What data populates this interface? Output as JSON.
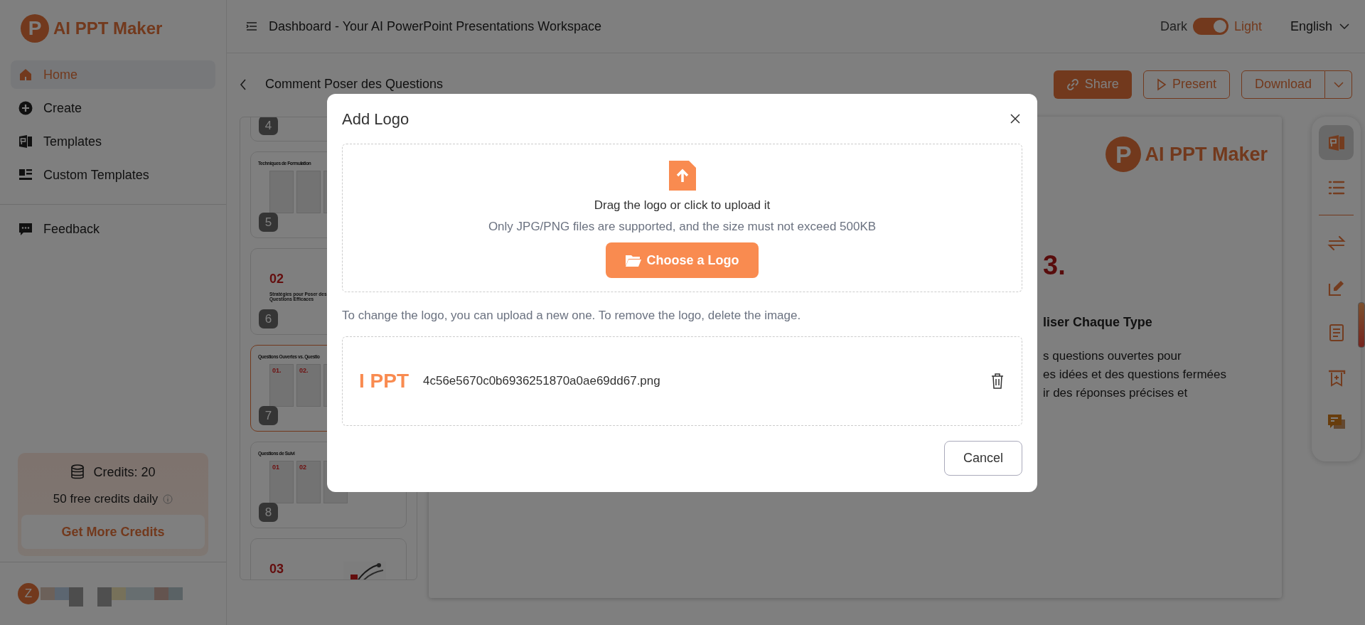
{
  "sidebar": {
    "logo": {
      "mark": "P",
      "name": "AI PPT Maker"
    },
    "nav": [
      {
        "label": "Home",
        "kind": "home",
        "selected": true
      },
      {
        "label": "Create",
        "kind": "create",
        "selected": false
      },
      {
        "label": "Templates",
        "kind": "templates",
        "selected": false
      },
      {
        "label": "Custom Templates",
        "kind": "custom",
        "selected": false
      }
    ],
    "secondary_nav": [
      {
        "label": "Feedback",
        "kind": "feedback",
        "selected": false
      }
    ],
    "credits": {
      "balance": "Credits: 20",
      "note": "50 free credits daily",
      "button": "Get More Credits"
    },
    "user": {
      "avatar": "Z"
    }
  },
  "topbar": {
    "title": "Dashboard - Your AI PowerPoint Presentations Workspace",
    "theme": [
      {
        "label": "Dark",
        "selected": false
      },
      {
        "label": "Light",
        "selected": true
      }
    ],
    "language": "English"
  },
  "presentation": {
    "title": "Comment Poser des Questions",
    "actions": [
      {
        "label": "Share",
        "kind": "primary"
      },
      {
        "label": "Present",
        "kind": "outline"
      },
      {
        "label": "Download",
        "kind": "split"
      }
    ]
  },
  "thumbnails": [
    {
      "number": "4",
      "kind": "blank",
      "selected": false
    },
    {
      "number": "5",
      "kind": "columns",
      "title": "Techniques de Formulation",
      "selected": false
    },
    {
      "number": "6",
      "kind": "section",
      "heading_number": "02",
      "title": "Stratégies pour Poser des Questions Efficaces",
      "selected": false
    },
    {
      "number": "7",
      "kind": "columns",
      "title": "Questions Ouvertes vs. Questio",
      "labels": [
        "01.",
        "02."
      ],
      "selected": true
    },
    {
      "number": "8",
      "kind": "columns",
      "title": "Questions de Suivi",
      "labels": [
        "01",
        "02"
      ],
      "selected": false
    },
    {
      "kind": "section_picture",
      "heading_number": "03",
      "selected": false
    }
  ],
  "slide": {
    "logo": {
      "mark": "P",
      "name": "AI PPT Maker"
    },
    "number": "3.",
    "heading": "liser Chaque Type",
    "body": [
      "s questions ouvertes pour",
      "es idées et des questions fermées",
      "ir des réponses précises et"
    ]
  },
  "tools": [
    {
      "kind": "slides",
      "selected": true
    },
    {
      "kind": "outline",
      "selected": false
    },
    {
      "kind": "switch",
      "selected": false
    },
    {
      "kind": "edit",
      "selected": false
    },
    {
      "kind": "notes",
      "selected": false
    },
    {
      "kind": "bookmark",
      "selected": false
    },
    {
      "kind": "comment",
      "selected": false
    }
  ],
  "modal": {
    "title": "Add Logo",
    "upload": {
      "prompt": "Drag the logo or click to upload it",
      "hint": "Only JPG/PNG files are supported, and the size must not exceed 500KB",
      "button": "Choose a Logo"
    },
    "info": "To change the logo, you can upload a new one. To remove the logo, delete the image.",
    "files": [
      {
        "preview": "I PPT",
        "name": "4c56e5670c0b6936251870a0ae69dd67.png"
      }
    ],
    "cancel": "Cancel"
  }
}
